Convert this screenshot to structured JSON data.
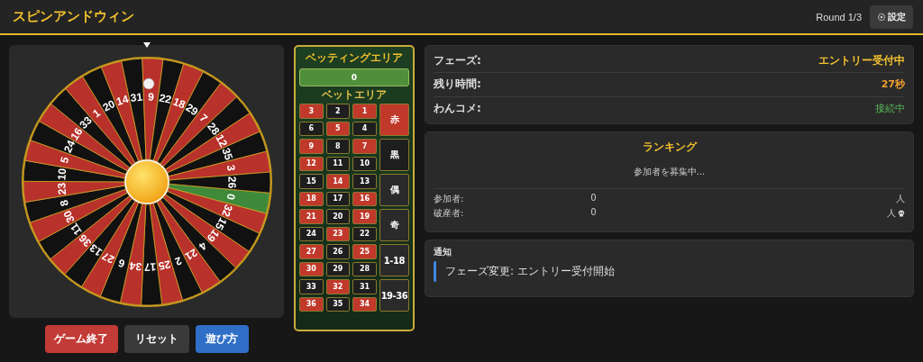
{
  "header": {
    "title": "スピンアンドウィン",
    "round": "Round 1/3",
    "settings_button": "設定"
  },
  "wheel": {
    "segments": [
      {
        "number": "0",
        "color": "#3f8a3a"
      },
      {
        "number": "32",
        "color": "#b8312b"
      },
      {
        "number": "15",
        "color": "#111111"
      },
      {
        "number": "19",
        "color": "#b8312b"
      },
      {
        "number": "4",
        "color": "#111111"
      },
      {
        "number": "21",
        "color": "#b8312b"
      },
      {
        "number": "2",
        "color": "#111111"
      },
      {
        "number": "25",
        "color": "#b8312b"
      },
      {
        "number": "17",
        "color": "#111111"
      },
      {
        "number": "34",
        "color": "#b8312b"
      },
      {
        "number": "6",
        "color": "#111111"
      },
      {
        "number": "27",
        "color": "#b8312b"
      },
      {
        "number": "13",
        "color": "#111111"
      },
      {
        "number": "36",
        "color": "#b8312b"
      },
      {
        "number": "11",
        "color": "#111111"
      },
      {
        "number": "30",
        "color": "#b8312b"
      },
      {
        "number": "8",
        "color": "#111111"
      },
      {
        "number": "23",
        "color": "#b8312b"
      },
      {
        "number": "10",
        "color": "#111111"
      },
      {
        "number": "5",
        "color": "#b8312b"
      },
      {
        "number": "24",
        "color": "#111111"
      },
      {
        "number": "16",
        "color": "#b8312b"
      },
      {
        "number": "33",
        "color": "#111111"
      },
      {
        "number": "1",
        "color": "#b8312b"
      },
      {
        "number": "20",
        "color": "#111111"
      },
      {
        "number": "14",
        "color": "#b8312b"
      },
      {
        "number": "31",
        "color": "#111111"
      },
      {
        "number": "9",
        "color": "#b8312b"
      },
      {
        "number": "22",
        "color": "#111111"
      },
      {
        "number": "18",
        "color": "#b8312b"
      },
      {
        "number": "29",
        "color": "#111111"
      },
      {
        "number": "7",
        "color": "#b8312b"
      },
      {
        "number": "28",
        "color": "#111111"
      },
      {
        "number": "12",
        "color": "#b8312b"
      },
      {
        "number": "35",
        "color": "#111111"
      },
      {
        "number": "3",
        "color": "#b8312b"
      },
      {
        "number": "26",
        "color": "#111111"
      }
    ]
  },
  "buttons": [
    {
      "label": "ゲーム終了",
      "kind": "danger"
    },
    {
      "label": "リセット",
      "kind": "neutral"
    },
    {
      "label": "遊び方",
      "kind": "primary"
    }
  ],
  "betting": {
    "title": "ベッティングエリア",
    "zero": "0",
    "subtitle": "ベットエリア",
    "numbers": [
      {
        "label": "3",
        "color": "#c0392b"
      },
      {
        "label": "2",
        "color": "#1e1e1e"
      },
      {
        "label": "1",
        "color": "#c0392b"
      },
      {
        "label": "6",
        "color": "#1e1e1e"
      },
      {
        "label": "5",
        "color": "#c0392b"
      },
      {
        "label": "4",
        "color": "#1e1e1e"
      },
      {
        "label": "9",
        "color": "#c0392b"
      },
      {
        "label": "8",
        "color": "#1e1e1e"
      },
      {
        "label": "7",
        "color": "#c0392b"
      },
      {
        "label": "12",
        "color": "#c0392b"
      },
      {
        "label": "11",
        "color": "#1e1e1e"
      },
      {
        "label": "10",
        "color": "#1e1e1e"
      },
      {
        "label": "15",
        "color": "#1e1e1e"
      },
      {
        "label": "14",
        "color": "#c0392b"
      },
      {
        "label": "13",
        "color": "#1e1e1e"
      },
      {
        "label": "18",
        "color": "#c0392b"
      },
      {
        "label": "17",
        "color": "#1e1e1e"
      },
      {
        "label": "16",
        "color": "#c0392b"
      },
      {
        "label": "21",
        "color": "#c0392b"
      },
      {
        "label": "20",
        "color": "#1e1e1e"
      },
      {
        "label": "19",
        "color": "#c0392b"
      },
      {
        "label": "24",
        "color": "#1e1e1e"
      },
      {
        "label": "23",
        "color": "#c0392b"
      },
      {
        "label": "22",
        "color": "#1e1e1e"
      },
      {
        "label": "27",
        "color": "#c0392b"
      },
      {
        "label": "26",
        "color": "#1e1e1e"
      },
      {
        "label": "25",
        "color": "#c0392b"
      },
      {
        "label": "30",
        "color": "#c0392b"
      },
      {
        "label": "29",
        "color": "#1e1e1e"
      },
      {
        "label": "28",
        "color": "#1e1e1e"
      },
      {
        "label": "33",
        "color": "#1e1e1e"
      },
      {
        "label": "32",
        "color": "#c0392b"
      },
      {
        "label": "31",
        "color": "#1e1e1e"
      },
      {
        "label": "36",
        "color": "#c0392b"
      },
      {
        "label": "35",
        "color": "#1e1e1e"
      },
      {
        "label": "34",
        "color": "#c0392b"
      }
    ],
    "outside": [
      {
        "label": "赤",
        "color": "#c0392b"
      },
      {
        "label": "黒",
        "color": "#1e1e1e"
      },
      {
        "label": "偶",
        "color": "#2a2a2a"
      },
      {
        "label": "奇",
        "color": "#2a2a2a"
      },
      {
        "label": "1-18",
        "color": "#2a2a2a"
      },
      {
        "label": "19-36",
        "color": "#2a2a2a"
      }
    ]
  },
  "status": [
    {
      "label": "フェーズ:",
      "value": "エントリー受付中",
      "kind": "phase"
    },
    {
      "label": "残り時間:",
      "value": "27秒",
      "kind": "timer"
    },
    {
      "label": "わんコメ:",
      "value": "接続中",
      "kind": "connection"
    }
  ],
  "ranking": {
    "title": "ランキング",
    "message": "参加者を募集中...",
    "stats": [
      {
        "label": "参加者:",
        "value": "0",
        "unit": "人",
        "kind": "participants"
      },
      {
        "label": "破産者:",
        "value": "0",
        "unit": "人",
        "kind": "bankrupt"
      }
    ]
  },
  "notifications": {
    "title": "通知",
    "items": [
      {
        "text": "フェーズ変更: エントリー受付開始"
      }
    ]
  }
}
